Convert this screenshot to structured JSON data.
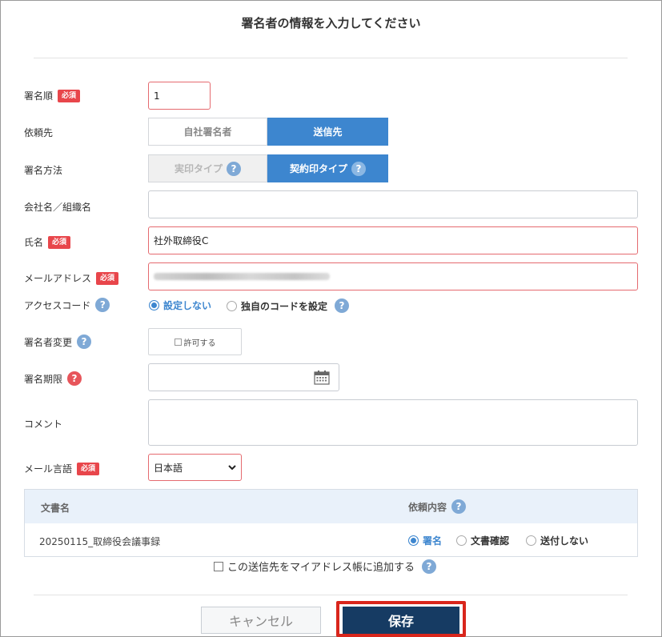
{
  "title": "署名者の情報を入力してください",
  "badge_required": "必須",
  "help_glyph": "?",
  "form": {
    "order": {
      "label": "署名順",
      "value": "1"
    },
    "request_to": {
      "label": "依頼先",
      "options": [
        "自社署名者",
        "送信先"
      ],
      "selected": "送信先"
    },
    "sign_method": {
      "label": "署名方法",
      "options": [
        "実印タイプ",
        "契約印タイプ"
      ],
      "selected": "契約印タイプ"
    },
    "company": {
      "label": "会社名／組織名",
      "value": ""
    },
    "name": {
      "label": "氏名",
      "value": "社外取締役C"
    },
    "email": {
      "label": "メールアドレス",
      "value": "(blurred)"
    },
    "access_code": {
      "label": "アクセスコード",
      "options": [
        "設定しない",
        "独自のコードを設定"
      ],
      "selected": "設定しない"
    },
    "signer_change": {
      "label": "署名者変更",
      "button": "許可する"
    },
    "deadline": {
      "label": "署名期限",
      "value": ""
    },
    "comment": {
      "label": "コメント",
      "value": ""
    },
    "mail_language": {
      "label": "メール言語",
      "value": "日本語"
    }
  },
  "documents": {
    "col_name": "文書名",
    "col_request": "依頼内容",
    "rows": [
      {
        "name": "20250115_取締役会議事録",
        "options": [
          "署名",
          "文書確認",
          "送付しない"
        ],
        "selected": "署名"
      }
    ]
  },
  "address_book": {
    "label": "この送信先をマイアドレス帳に追加する"
  },
  "buttons": {
    "cancel": "キャンセル",
    "save": "保存"
  },
  "colors": {
    "accent": "#3d86cf",
    "required": "#e8464b",
    "save_bg": "#163b63",
    "highlight": "#d9261c"
  }
}
